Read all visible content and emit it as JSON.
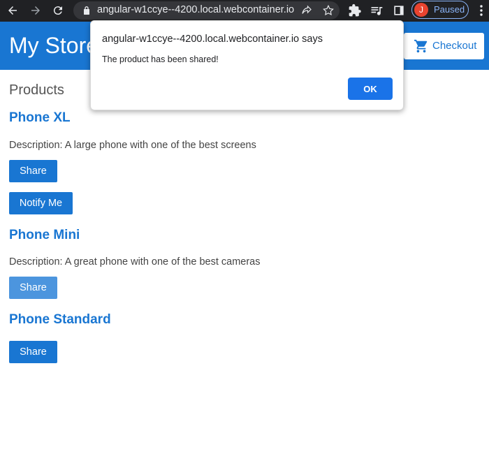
{
  "browser": {
    "url": "angular-w1ccye--4200.local.webcontainer.io",
    "profile_initial": "J",
    "profile_status": "Paused",
    "icons": [
      "back-arrow-icon",
      "forward-arrow-icon",
      "reload-icon",
      "lock-icon",
      "share-icon",
      "star-icon",
      "extensions-icon",
      "media-icon",
      "side-panel-icon",
      "more-menu-icon"
    ]
  },
  "topbar": {
    "title": "My Store",
    "checkout_label": "Checkout",
    "color": "#1976d2"
  },
  "main": {
    "heading": "Products",
    "products": [
      {
        "name": "Phone XL",
        "description": "Description: A large phone with one of the best screens",
        "share_label": "Share",
        "notify_label": "Notify Me"
      },
      {
        "name": "Phone Mini",
        "description": "Description: A great phone with one of the best cameras",
        "share_label": "Share"
      },
      {
        "name": "Phone Standard",
        "share_label": "Share"
      }
    ]
  },
  "dialog": {
    "title": "angular-w1ccye--4200.local.webcontainer.io says",
    "message": "The product has been shared!",
    "ok_label": "OK",
    "ok_color": "#1a73e8"
  }
}
